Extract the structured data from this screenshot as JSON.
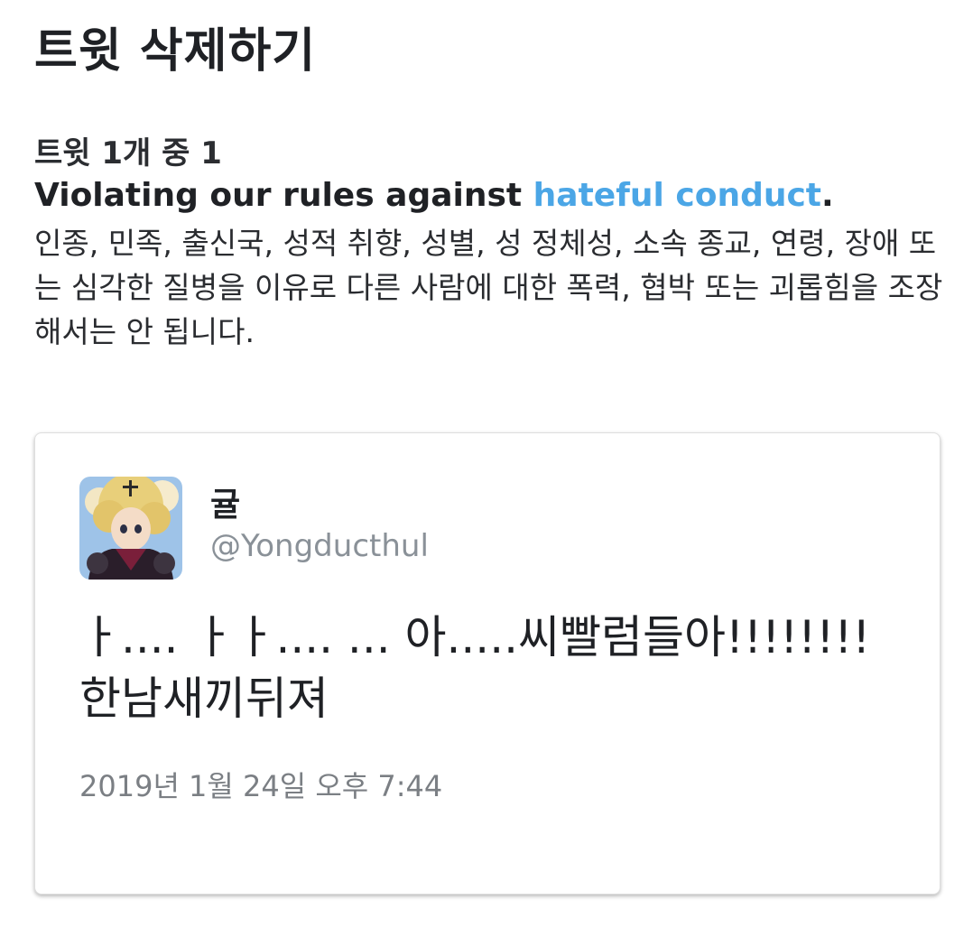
{
  "header": {
    "title": "트윗 삭제하기"
  },
  "notice": {
    "count_text": "트윗 1개 중 1",
    "violation_prefix": "Violating our rules against ",
    "violation_link": "hateful conduct",
    "violation_suffix": ".",
    "description": "인종, 민족, 출신국, 성적 취향, 성별, 성 정체성, 소속 종교, 연령, 장애 또는 심각한 질병을 이유로 다른 사람에 대한 폭력, 협박 또는 괴롭힘을 조장해서는 안 됩니다."
  },
  "tweet": {
    "display_name": "귤",
    "handle": "@Yongducthul",
    "text_line1": "ㅏ.... ㅏㅏ.... ... 아.....씨빨럼들아!!!!!!!!",
    "text_line2": "한남새끼뒤져",
    "timestamp": "2019년 1월 24일 오후 7:44"
  },
  "colors": {
    "link": "#4ba6e6",
    "handle": "#8a9198",
    "timestamp": "#7b7f84"
  }
}
